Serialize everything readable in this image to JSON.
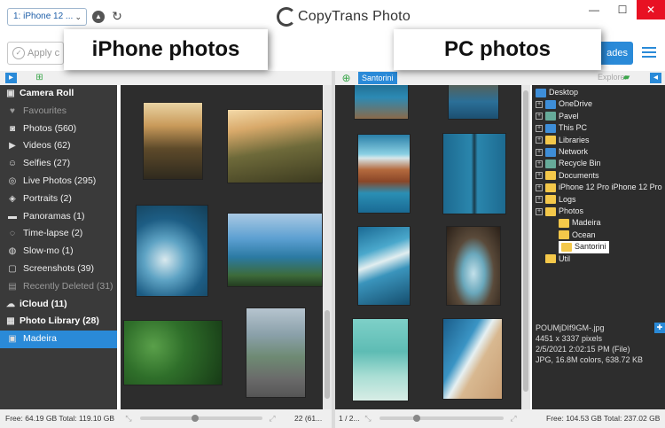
{
  "app": {
    "title": "CopyTrans Photo",
    "device": "1: iPhone 12 ...",
    "apply_label": "Apply c",
    "start_label": "ades"
  },
  "annotations": {
    "left": "iPhone photos",
    "right": "PC photos"
  },
  "left_panel": {
    "sidebar": [
      {
        "label": "Camera Roll",
        "icon": "camera-roll-icon",
        "glyph": "▣",
        "head": true
      },
      {
        "label": "Favourites",
        "icon": "heart-icon",
        "glyph": "♥",
        "dim": true
      },
      {
        "label": "Photos (560)",
        "icon": "camera-icon",
        "glyph": "◙"
      },
      {
        "label": "Videos (62)",
        "icon": "video-icon",
        "glyph": "▶"
      },
      {
        "label": "Selfies (27)",
        "icon": "selfie-icon",
        "glyph": "☺"
      },
      {
        "label": "Live Photos (295)",
        "icon": "live-photo-icon",
        "glyph": "◎"
      },
      {
        "label": "Portraits (2)",
        "icon": "portrait-icon",
        "glyph": "◈"
      },
      {
        "label": "Panoramas (1)",
        "icon": "panorama-icon",
        "glyph": "▬"
      },
      {
        "label": "Time-lapse (2)",
        "icon": "timelapse-icon",
        "glyph": "◌"
      },
      {
        "label": "Slow-mo (1)",
        "icon": "slowmo-icon",
        "glyph": "◍"
      },
      {
        "label": "Screenshots (39)",
        "icon": "screenshot-icon",
        "glyph": "▢"
      },
      {
        "label": "Recently Deleted (31)",
        "icon": "trash-icon",
        "glyph": "▤",
        "dim": true
      },
      {
        "label": "iCloud (11)",
        "icon": "cloud-icon",
        "glyph": "☁",
        "head": true
      },
      {
        "label": "Photo Library (28)",
        "icon": "library-icon",
        "glyph": "▦",
        "head": true
      },
      {
        "label": "Madeira",
        "icon": "album-icon",
        "glyph": "▣",
        "selected": true
      }
    ],
    "footer_storage": "Free: 64.19 GB Total: 119.10 GB",
    "footer_count": "22 (61...",
    "slider_level": 0.45
  },
  "right_panel": {
    "album_tag": "Santorini",
    "explorer_label": "Explorer",
    "tree": [
      {
        "label": "Desktop",
        "icon": "desktop-icon",
        "color": "fold-b",
        "indent": 0,
        "exp": false
      },
      {
        "label": "OneDrive",
        "icon": "onedrive-icon",
        "color": "fold-b",
        "indent": 1,
        "exp": true
      },
      {
        "label": "Pavel",
        "icon": "user-folder-icon",
        "color": "fold-g",
        "indent": 1,
        "exp": true
      },
      {
        "label": "This PC",
        "icon": "pc-icon",
        "color": "fold-b",
        "indent": 1,
        "exp": true
      },
      {
        "label": "Libraries",
        "icon": "libraries-icon",
        "color": "fold-y",
        "indent": 1,
        "exp": true
      },
      {
        "label": "Network",
        "icon": "network-icon",
        "color": "fold-b",
        "indent": 1,
        "exp": true
      },
      {
        "label": "Recycle Bin",
        "icon": "recycle-bin-icon",
        "color": "fold-g",
        "indent": 1,
        "exp": true
      },
      {
        "label": "Documents",
        "icon": "folder-icon",
        "color": "fold-y",
        "indent": 1,
        "exp": true
      },
      {
        "label": "iPhone 12 Pro iPhone 12 Pro",
        "icon": "folder-icon",
        "color": "fold-y",
        "indent": 1,
        "exp": true
      },
      {
        "label": "Logs",
        "icon": "folder-icon",
        "color": "fold-y",
        "indent": 1,
        "exp": true
      },
      {
        "label": "Photos",
        "icon": "folder-icon",
        "color": "fold-y",
        "indent": 1,
        "exp": true
      },
      {
        "label": "Madeira",
        "icon": "folder-icon",
        "color": "fold-y",
        "indent": 2,
        "exp": false
      },
      {
        "label": "Ocean",
        "icon": "folder-icon",
        "color": "fold-y",
        "indent": 2,
        "exp": false
      },
      {
        "label": "Santorini",
        "icon": "folder-icon",
        "color": "fold-y",
        "indent": 2,
        "exp": false,
        "selected": true
      },
      {
        "label": "Util",
        "icon": "folder-icon",
        "color": "fold-y",
        "indent": 1,
        "exp": false
      }
    ],
    "file_info": [
      "POUMjDIf9GM-.jpg",
      "4451 x 3337 pixels",
      "2/5/2021 2:02:15 PM  (File)",
      "JPG, 16.8M colors, 638.72 KB"
    ],
    "footer_page": "1 / 2...",
    "footer_storage": "Free: 104.53 GB Total: 237.02 GB",
    "slider_level": 0.3
  }
}
